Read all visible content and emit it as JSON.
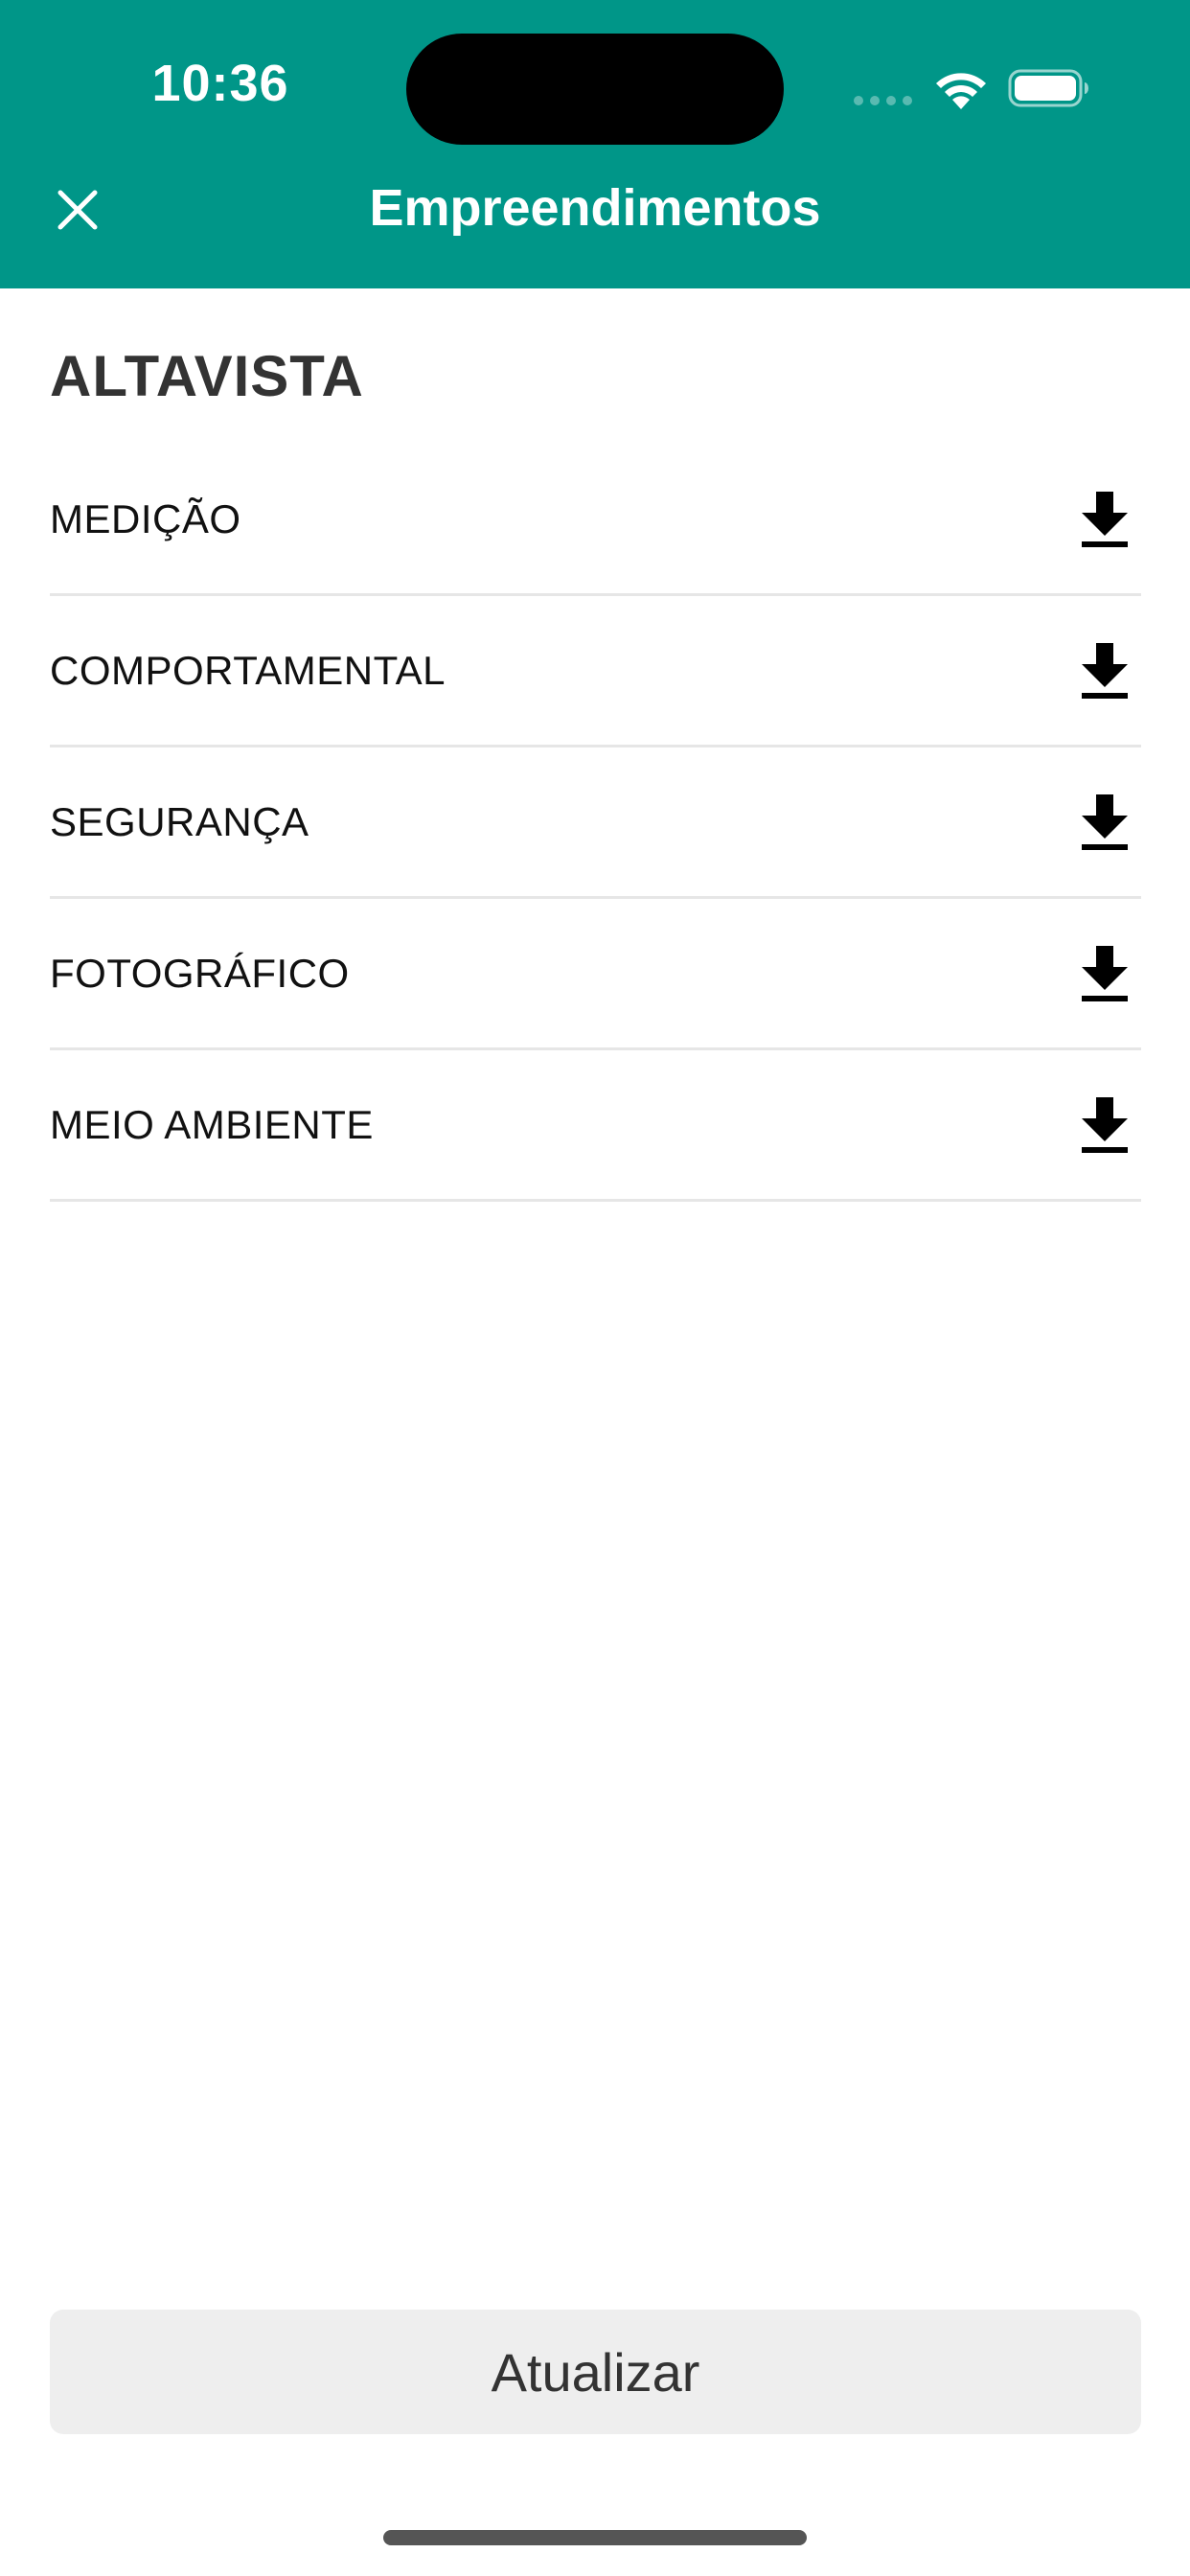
{
  "status_bar": {
    "time": "10:36"
  },
  "header": {
    "title": "Empreendimentos",
    "close_icon": "close-icon",
    "background": "#009688"
  },
  "section": {
    "title": "ALTAVISTA"
  },
  "items": [
    {
      "label": "MEDIÇÃO",
      "icon": "download-icon"
    },
    {
      "label": "COMPORTAMENTAL",
      "icon": "download-icon"
    },
    {
      "label": "SEGURANÇA",
      "icon": "download-icon"
    },
    {
      "label": "FOTOGRÁFICO",
      "icon": "download-icon"
    },
    {
      "label": "MEIO AMBIENTE",
      "icon": "download-icon"
    }
  ],
  "footer": {
    "refresh_label": "Atualizar"
  }
}
